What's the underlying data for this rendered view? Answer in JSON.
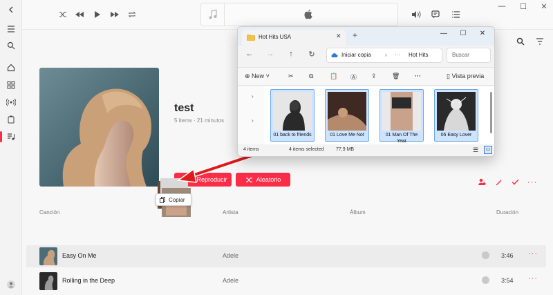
{
  "app": {
    "top_icons": [
      "back-icon",
      "shuffle-icon",
      "previous-icon",
      "play-icon",
      "next-icon",
      "repeat-icon",
      "music-note-icon",
      "apple-logo-icon",
      "volume-icon",
      "lyrics-icon",
      "queue-icon"
    ],
    "rail_icons": [
      "menu-icon",
      "search-icon",
      "home-icon",
      "browse-icon",
      "radio-icon",
      "library-icon",
      "playlist-icon",
      "account-icon"
    ]
  },
  "playlist": {
    "title": "test",
    "subtitle": "5 items · 21 minutos",
    "play_label": "Reproducir",
    "shuffle_label": "Aleatorio"
  },
  "columns": {
    "song": "Canción",
    "artist": "Artista",
    "album": "Álbum",
    "duration": "Duración"
  },
  "tracks": [
    {
      "title": "Easy On Me",
      "artist": "Adele",
      "duration": "3:46"
    },
    {
      "title": "Rolling in the Deep",
      "artist": "Adele",
      "duration": "3:54"
    }
  ],
  "drag": {
    "tooltip": "Copiar"
  },
  "explorer": {
    "tab_title": "Hot Hits USA",
    "breadcrumb_1": "Iniciar copia",
    "breadcrumb_2": "Hot Hits",
    "search_placeholder": "Buscar",
    "new_label": "New",
    "preview_label": "Vista previa",
    "files": [
      {
        "name": "01 back to friends"
      },
      {
        "name": "01 Love Me Not"
      },
      {
        "name": "01 Man Of The Year"
      },
      {
        "name": "06 Easy Lover"
      }
    ],
    "status_items": "4 items",
    "status_selected": "4 items selected",
    "status_size": "77,9 MB"
  },
  "colors": {
    "accent": "#fa2d48",
    "selection": "#cce4ff"
  }
}
